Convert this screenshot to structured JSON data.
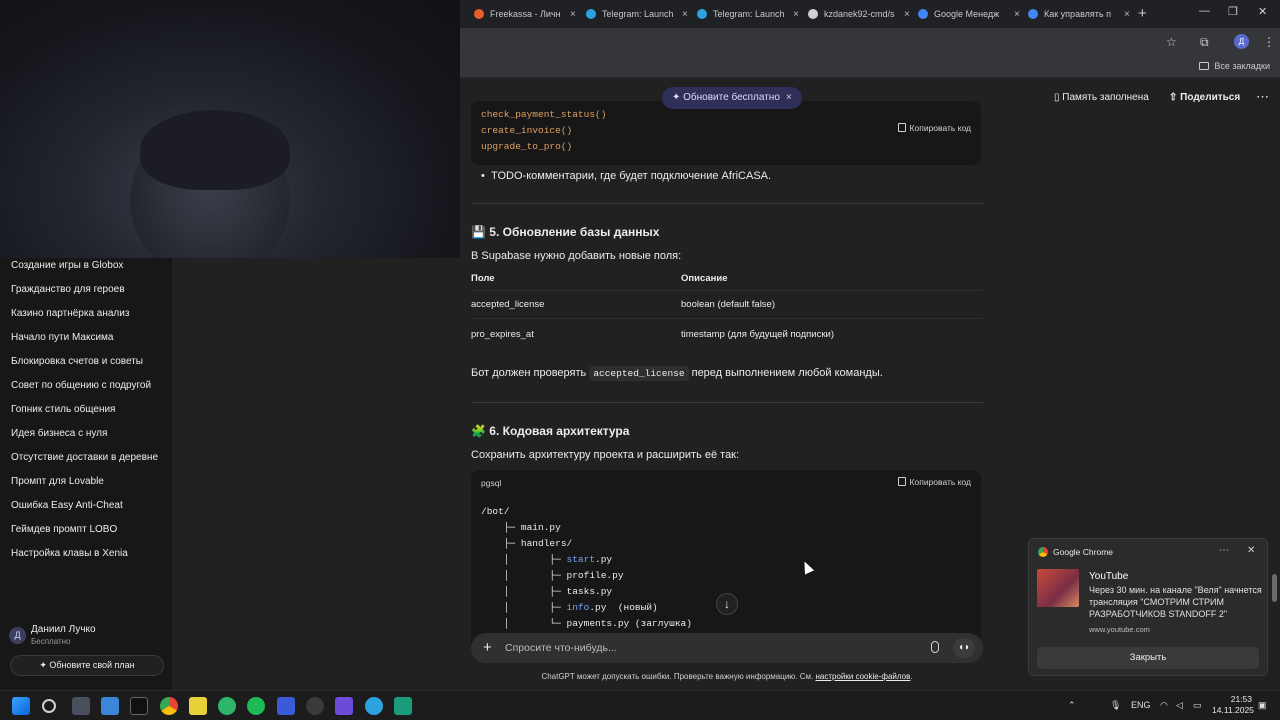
{
  "browser": {
    "tabs": [
      {
        "title": "Freekassa - Личн",
        "favicon": "#e85d2a"
      },
      {
        "title": "Telegram: Launch",
        "favicon": "#2aa3e0"
      },
      {
        "title": "Telegram: Launch",
        "favicon": "#2aa3e0"
      },
      {
        "title": "kzdanek92-cmd/s",
        "favicon": "#d0d0d0"
      },
      {
        "title": "Google Менедж",
        "favicon": "#4285f4"
      },
      {
        "title": "Как управлять п",
        "favicon": "#4285f4"
      }
    ],
    "new_tab": "+",
    "tab_close": "×",
    "window_min": "—",
    "window_max": "❐",
    "window_close": "✕",
    "profile_initial": "Д",
    "all_bookmarks": "Все закладки"
  },
  "sidebar": {
    "chats": [
      "Создание игры в Globox",
      "Гражданство для героев",
      "Казино партнёрка анализ",
      "Начало пути Максима",
      "Блокировка счетов и советы",
      "Совет по общению с подругой",
      "Гопник стиль общения",
      "Идея бизнеса с нуля",
      "Отсутствие доставки в деревне",
      "Промпт для Lovable",
      "Ошибка Easy Anti-Cheat",
      "Геймдев промпт LOBO",
      "Настройка клавы в Xenia"
    ],
    "user": {
      "initial": "Д",
      "name": "Даниил Лучко",
      "plan": "Бесплатно"
    },
    "upgrade_button": "Обновите свой план"
  },
  "topbar": {
    "promo": "✦ Обновите бесплатно",
    "promo_close": "×",
    "memory": "Память заполнена",
    "share": "Поделиться",
    "more": "⋯"
  },
  "message": {
    "code1": {
      "lines": [
        "check_payment_status()",
        "create_invoice()",
        "upgrade_to_pro()"
      ],
      "copy": "Копировать код"
    },
    "bullet": "TODO-комментарии, где будет подключение AfriCASA.",
    "section5": {
      "title": "💾 5. Обновление базы данных",
      "intro": "В Supabase нужно добавить новые поля:",
      "table": {
        "headers": [
          "Поле",
          "Описание"
        ],
        "rows": [
          [
            "accepted_license",
            "boolean (default false)"
          ],
          [
            "pro_expires_at",
            "timestamp (для будущей подписки)"
          ]
        ]
      },
      "note_before": "Бот должен проверять",
      "note_code": "accepted_license",
      "note_after": "перед выполнением любой команды."
    },
    "section6": {
      "title": "🧩 6. Кодовая архитектура",
      "intro": "Сохранить архитектуру проекта и расширить её так:",
      "code": {
        "lang": "pgsql",
        "copy": "Копировать код",
        "lines": [
          "/bot/",
          "    ├─ main.py",
          "    ├─ handlers/",
          "    │       ├─ start.py",
          "    │       ├─ profile.py",
          "    │       ├─ tasks.py",
          "    │       ├─ info.py  (новый)",
          "    │       └─ payments.py (заглушка)"
        ]
      }
    }
  },
  "composer": {
    "placeholder": "Спросите что-нибудь...",
    "plus": "+",
    "voice": "◖◗",
    "scroll_down": "↓"
  },
  "disclaimer": {
    "text": "ChatGPT может допускать ошибки. Проверьте важную информацию. См.",
    "link": "настройки cookie-файлов"
  },
  "notification": {
    "app": "Google Chrome",
    "more": "⋯",
    "close": "✕",
    "title": "YouTube",
    "body": "Через 30 мин. на канале \"Веля\" начнется трансляция \"СМОТРИМ СТРИМ РАЗРАБОТЧИКОВ STANDOFF 2\"",
    "site": "www.youtube.com",
    "button": "Закрыть"
  },
  "taskbar": {
    "lang": "ENG",
    "time": "21:53",
    "date": "14.11.2025"
  }
}
